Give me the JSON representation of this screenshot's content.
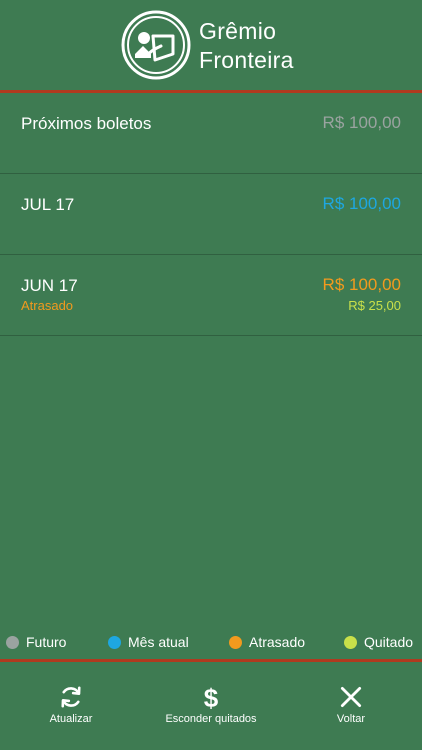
{
  "header": {
    "title_line1": "Grêmio",
    "title_line2": "Fronteira",
    "logo_icon": "club-crest-icon"
  },
  "colors": {
    "background": "#3e7b52",
    "separator": "#b03a1f",
    "futuro": "#9aa3a0",
    "mes_atual": "#1ea7e1",
    "atrasado": "#f29a1e",
    "quitado": "#c9e04a"
  },
  "bills": [
    {
      "label": "Próximos boletos",
      "amount": "R$ 100,00",
      "status": "futuro"
    },
    {
      "label": "JUL 17",
      "amount": "R$ 100,00",
      "status": "mes_atual"
    },
    {
      "label": "JUN 17",
      "amount": "R$ 100,00",
      "status": "atrasado",
      "status_text": "Atrasado",
      "paid_amount": "R$ 25,00"
    }
  ],
  "legend": [
    {
      "label": "Futuro",
      "color": "#9aa3a0"
    },
    {
      "label": "Mês atual",
      "color": "#1ea7e1"
    },
    {
      "label": "Atrasado",
      "color": "#f29a1e"
    },
    {
      "label": "Quitado",
      "color": "#c9e04a"
    }
  ],
  "toolbar": {
    "refresh_label": "Atualizar",
    "refresh_icon": "refresh-icon",
    "hide_paid_label": "Esconder quitados",
    "hide_paid_icon": "dollar-icon",
    "back_label": "Voltar",
    "back_icon": "close-icon"
  }
}
